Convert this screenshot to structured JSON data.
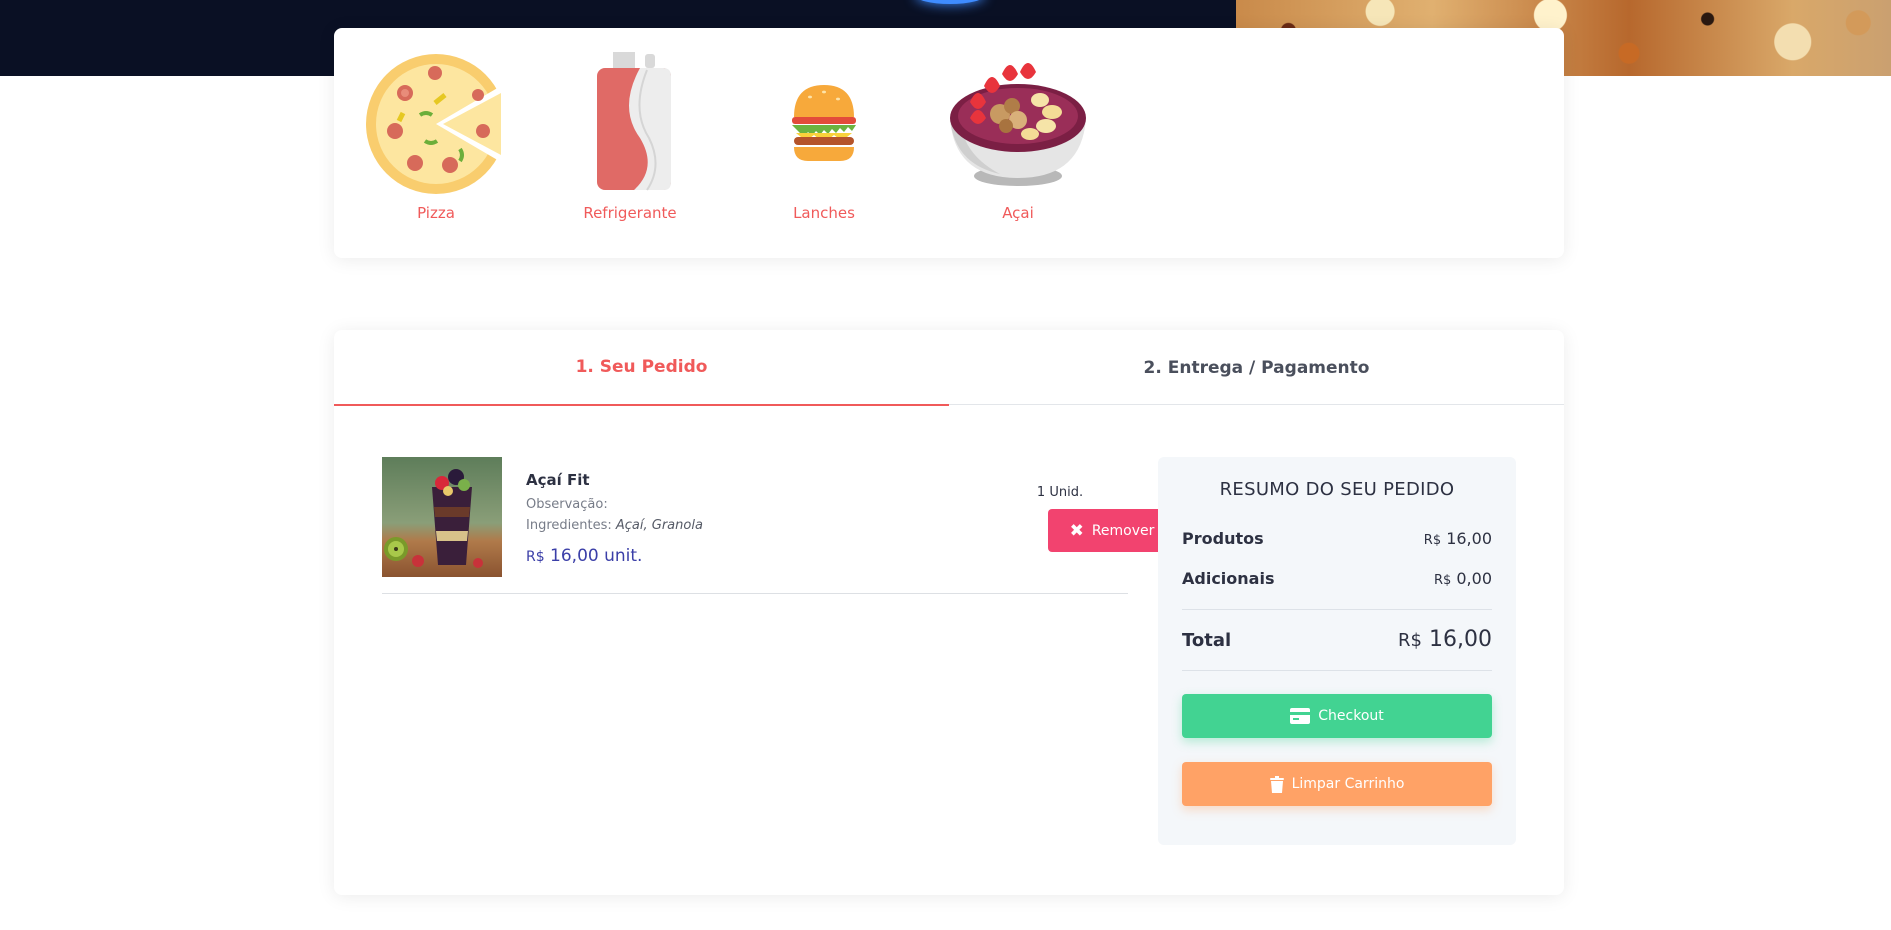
{
  "colors": {
    "accent": "#f05a5a",
    "remove": "#f2436f",
    "checkout": "#42d392",
    "clear": "#ffa266",
    "price": "#3b3fa8"
  },
  "categories": [
    {
      "label": "Pizza",
      "icon": "pizza-icon"
    },
    {
      "label": "Refrigerante",
      "icon": "soda-can-icon"
    },
    {
      "label": "Lanches",
      "icon": "burger-icon"
    },
    {
      "label": "Açai",
      "icon": "acai-bowl-icon"
    }
  ],
  "tabs": [
    {
      "label": "1. Seu Pedido",
      "active": true
    },
    {
      "label": "2. Entrega / Pagamento",
      "active": false
    }
  ],
  "cart_item": {
    "name": "Açaí Fit",
    "obs_label": "Observação:",
    "ing_label": "Ingredientes:",
    "ingredients": "Açaí, Granola",
    "currency": "R$",
    "price": "16,00 unit.",
    "qty": "1 Unid.",
    "remove_label": "Remover"
  },
  "summary": {
    "title": "RESUMO DO SEU PEDIDO",
    "produtos_label": "Produtos",
    "produtos_cur": "R$",
    "produtos_value": "16,00",
    "adicionais_label": "Adicionais",
    "adicionais_cur": "R$",
    "adicionais_value": "0,00",
    "total_label": "Total",
    "total_cur": "R$",
    "total_value": "16,00",
    "checkout_label": "Checkout",
    "clear_label": "Limpar Carrinho"
  }
}
